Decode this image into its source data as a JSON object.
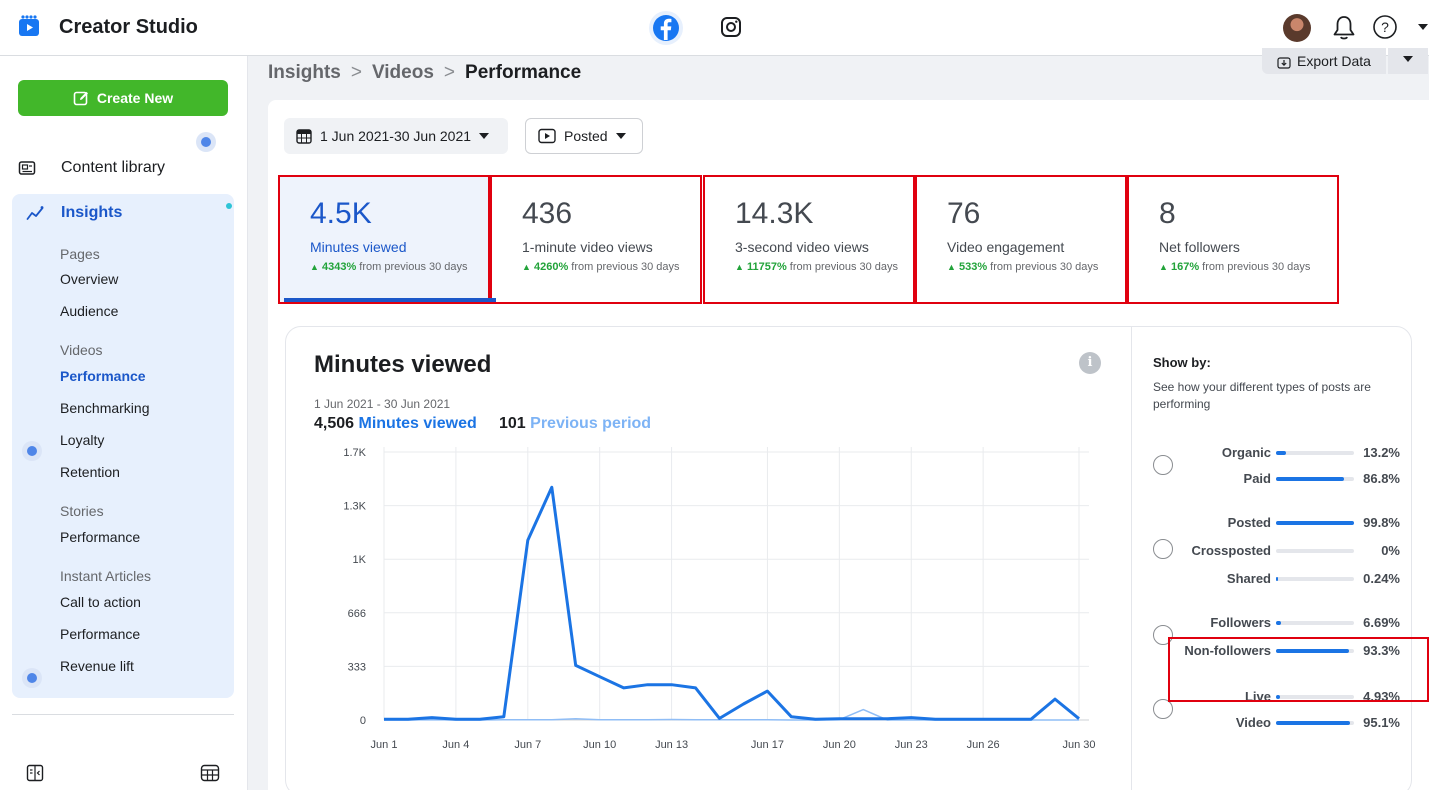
{
  "app": {
    "title": "Creator Studio"
  },
  "header": {
    "icons": [
      "facebook-icon",
      "instagram-icon",
      "avatar",
      "bell-icon",
      "help-icon",
      "chevron-down-icon"
    ]
  },
  "sidebar": {
    "create_label": "Create New",
    "content_library": "Content library",
    "insights": "Insights",
    "sections": {
      "pages": "Pages",
      "videos": "Videos",
      "stories": "Stories",
      "instant_articles": "Instant Articles"
    },
    "items": {
      "overview": "Overview",
      "audience": "Audience",
      "performance": "Performance",
      "benchmarking": "Benchmarking",
      "loyalty": "Loyalty",
      "retention": "Retention",
      "stories_performance": "Performance",
      "call_to_action": "Call to action",
      "articles_performance": "Performance",
      "revenue_lift": "Revenue lift"
    }
  },
  "breadcrumb": {
    "a": "Insights",
    "b": "Videos",
    "c": "Performance",
    "sep": ">"
  },
  "export_label": "Export Data",
  "filters": {
    "date": "1 Jun 2021-30 Jun 2021",
    "posted": "Posted"
  },
  "metrics": [
    {
      "value": "4.5K",
      "label": "Minutes viewed",
      "change": "4343%",
      "suffix": " from previous 30 days"
    },
    {
      "value": "436",
      "label": "1-minute video views",
      "change": "4260%",
      "suffix": " from previous 30 days"
    },
    {
      "value": "14.3K",
      "label": "3-second video views",
      "change": "11757%",
      "suffix": " from previous 30 days"
    },
    {
      "value": "76",
      "label": "Video engagement",
      "change": "533%",
      "suffix": " from previous 30 days"
    },
    {
      "value": "8",
      "label": "Net followers",
      "change": "167%",
      "suffix": " from previous 30 days"
    }
  ],
  "chart_card": {
    "title": "Minutes viewed",
    "range": "1 Jun 2021 - 30 Jun 2021",
    "total_value": "4,506",
    "total_label": "Minutes viewed",
    "prev_value": "101",
    "prev_label": "Previous period"
  },
  "chart_data": {
    "type": "line",
    "x": [
      "Jun 1",
      "Jun 2",
      "Jun 3",
      "Jun 4",
      "Jun 5",
      "Jun 6",
      "Jun 7",
      "Jun 8",
      "Jun 9",
      "Jun 10",
      "Jun 11",
      "Jun 12",
      "Jun 13",
      "Jun 14",
      "Jun 15",
      "Jun 16",
      "Jun 17",
      "Jun 18",
      "Jun 19",
      "Jun 20",
      "Jun 21",
      "Jun 22",
      "Jun 23",
      "Jun 24",
      "Jun 25",
      "Jun 26",
      "Jun 27",
      "Jun 28",
      "Jun 29",
      "Jun 30"
    ],
    "xticks": [
      "Jun 1",
      "Jun 4",
      "Jun 7",
      "Jun 10",
      "Jun 13",
      "Jun 17",
      "Jun 20",
      "Jun 23",
      "Jun 26",
      "Jun 30"
    ],
    "yticks": [
      "0",
      "333",
      "666",
      "1K",
      "1.3K",
      "1.7K"
    ],
    "ylim": [
      0,
      1670
    ],
    "grid": true,
    "series": [
      {
        "name": "Minutes viewed",
        "color": "#1b74e4",
        "values": [
          5,
          5,
          15,
          5,
          5,
          20,
          1120,
          1450,
          340,
          270,
          200,
          220,
          220,
          200,
          10,
          100,
          180,
          20,
          5,
          8,
          8,
          8,
          15,
          5,
          5,
          5,
          5,
          5,
          130,
          8
        ]
      },
      {
        "name": "Previous period",
        "color": "#8fbdf6",
        "values": [
          0,
          0,
          2,
          0,
          0,
          2,
          2,
          2,
          8,
          2,
          2,
          2,
          3,
          2,
          2,
          2,
          2,
          0,
          0,
          2,
          65,
          0,
          0,
          0,
          0,
          0,
          0,
          0,
          0,
          0
        ]
      }
    ]
  },
  "showby": {
    "heading": "Show by:",
    "description": "See how your different types of posts are performing",
    "groups": [
      {
        "rows": [
          {
            "name": "Organic",
            "pct": "13.2%",
            "frac": 0.132
          },
          {
            "name": "Paid",
            "pct": "86.8%",
            "frac": 0.868
          }
        ]
      },
      {
        "rows": [
          {
            "name": "Posted",
            "pct": "99.8%",
            "frac": 0.998
          },
          {
            "name": "Crossposted",
            "pct": "0%",
            "frac": 0
          },
          {
            "name": "Shared",
            "pct": "0.24%",
            "frac": 0.0024
          }
        ]
      },
      {
        "rows": [
          {
            "name": "Followers",
            "pct": "6.69%",
            "frac": 0.0669
          },
          {
            "name": "Non-followers",
            "pct": "93.3%",
            "frac": 0.933
          }
        ]
      },
      {
        "rows": [
          {
            "name": "Live",
            "pct": "4.93%",
            "frac": 0.0493
          },
          {
            "name": "Video",
            "pct": "95.1%",
            "frac": 0.951
          }
        ]
      }
    ]
  }
}
